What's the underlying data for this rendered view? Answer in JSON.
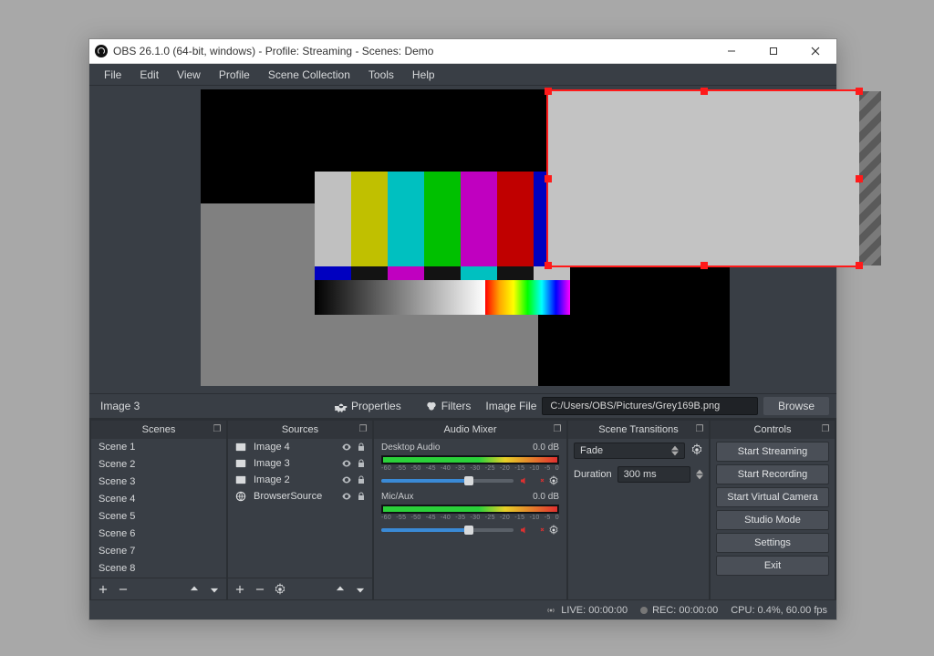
{
  "title": "OBS 26.1.0 (64-bit, windows) - Profile: Streaming - Scenes: Demo",
  "menubar": [
    "File",
    "Edit",
    "View",
    "Profile",
    "Scene Collection",
    "Tools",
    "Help"
  ],
  "context": {
    "selected_source": "Image 3",
    "properties_label": "Properties",
    "filters_label": "Filters",
    "field_label": "Image File",
    "field_value": "C:/Users/OBS/Pictures/Grey169B.png",
    "browse_label": "Browse"
  },
  "docks": {
    "scenes": {
      "title": "Scenes",
      "items": [
        "Scene 1",
        "Scene 2",
        "Scene 3",
        "Scene 4",
        "Scene 5",
        "Scene 6",
        "Scene 7",
        "Scene 8"
      ]
    },
    "sources": {
      "title": "Sources",
      "items": [
        {
          "label": "Image 4",
          "type": "image"
        },
        {
          "label": "Image 3",
          "type": "image"
        },
        {
          "label": "Image 2",
          "type": "image"
        },
        {
          "label": "BrowserSource",
          "type": "browser"
        }
      ]
    },
    "mixer": {
      "title": "Audio Mixer",
      "ticks": [
        "-60",
        "-55",
        "-50",
        "-45",
        "-40",
        "-35",
        "-30",
        "-25",
        "-20",
        "-15",
        "-10",
        "-5",
        "0"
      ],
      "channels": [
        {
          "name": "Desktop Audio",
          "level": "0.0 dB"
        },
        {
          "name": "Mic/Aux",
          "level": "0.0 dB"
        }
      ]
    },
    "transitions": {
      "title": "Scene Transitions",
      "selected": "Fade",
      "duration_label": "Duration",
      "duration": "300 ms"
    },
    "controls": {
      "title": "Controls",
      "buttons": [
        "Start Streaming",
        "Start Recording",
        "Start Virtual Camera",
        "Studio Mode",
        "Settings",
        "Exit"
      ]
    }
  },
  "status": {
    "live": "LIVE: 00:00:00",
    "rec": "REC: 00:00:00",
    "cpu": "CPU: 0.4%, 60.00 fps"
  }
}
